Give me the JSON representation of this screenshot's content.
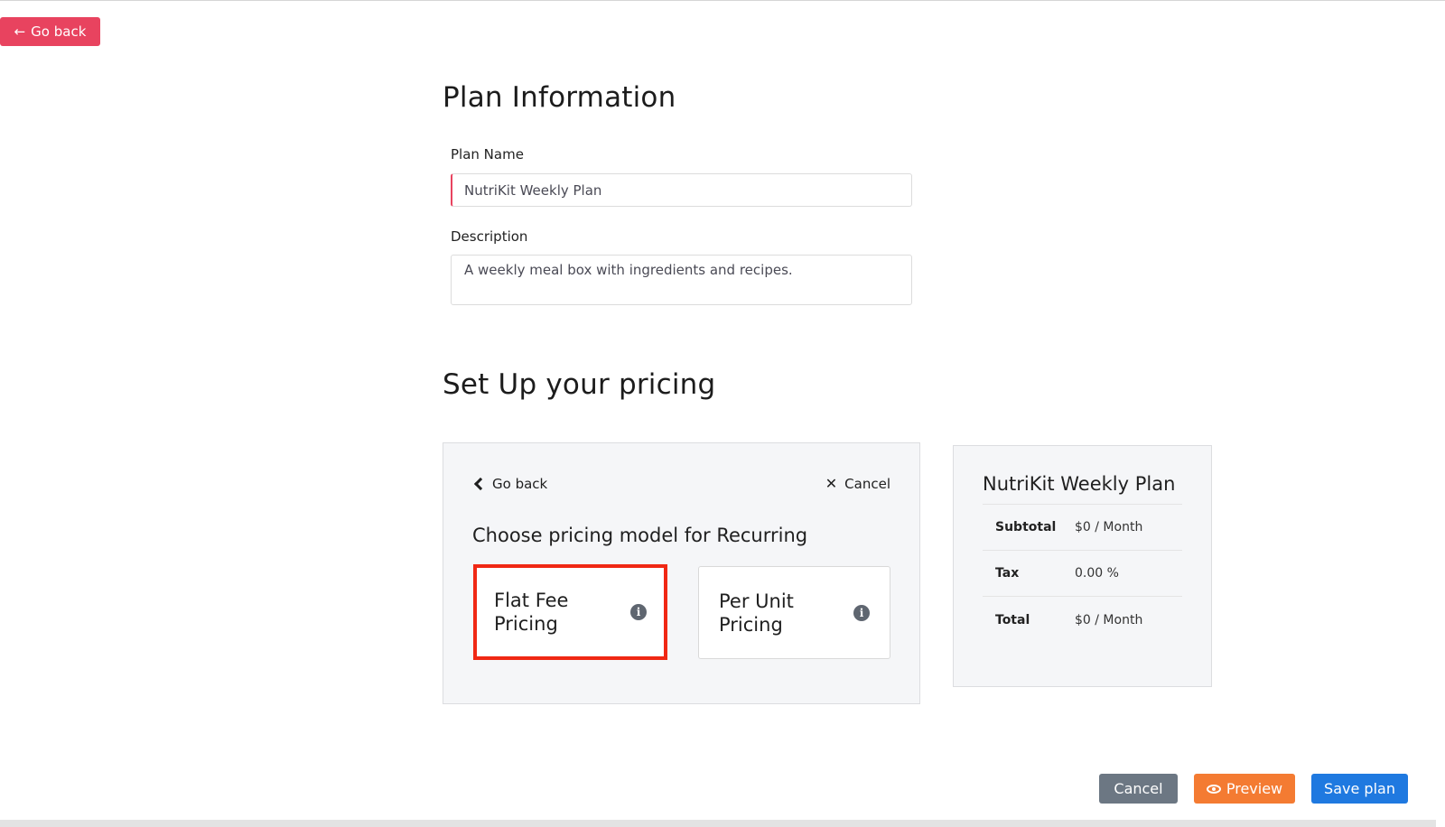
{
  "top": {
    "go_back_label": "Go back"
  },
  "plan_info": {
    "title": "Plan Information",
    "name_label": "Plan Name",
    "name_value": "NutriKit Weekly Plan",
    "description_label": "Description",
    "description_value": "A weekly meal box with ingredients and recipes."
  },
  "pricing": {
    "title": "Set Up your pricing",
    "panel": {
      "go_back_label": "Go back",
      "cancel_label": "Cancel",
      "heading": "Choose pricing model for Recurring",
      "options": [
        {
          "label": "Flat Fee Pricing",
          "icon": "info-icon",
          "selected": true
        },
        {
          "label": "Per Unit Pricing",
          "icon": "info-icon",
          "selected": false
        }
      ]
    },
    "summary": {
      "title": "NutriKit Weekly Plan",
      "rows": [
        {
          "key": "Subtotal",
          "value": "$0 / Month"
        },
        {
          "key": "Tax",
          "value": "0.00 %"
        },
        {
          "key": "Total",
          "value": "$0 / Month"
        }
      ]
    }
  },
  "footer": {
    "cancel_label": "Cancel",
    "preview_label": "Preview",
    "save_label": "Save plan"
  },
  "colors": {
    "go_back": "#e8435f",
    "highlight": "#f02814",
    "cancel": "#6c7783",
    "preview": "#f47b32",
    "save": "#1f79e0"
  }
}
